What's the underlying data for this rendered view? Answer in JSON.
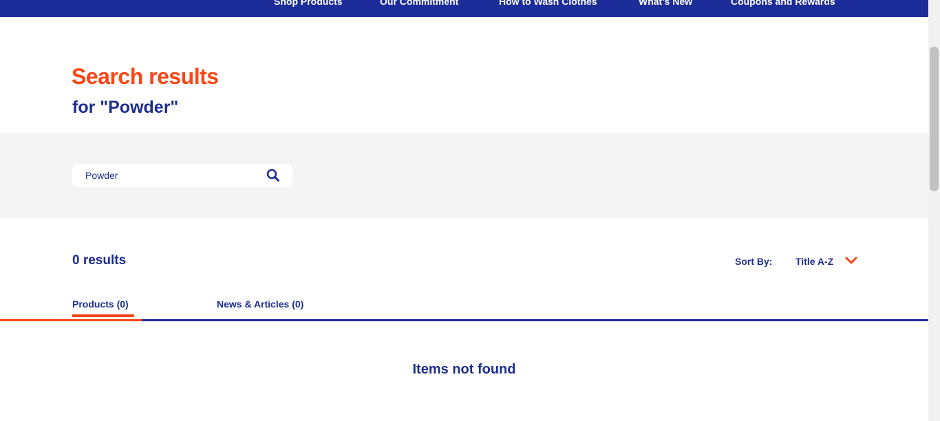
{
  "nav": {
    "items": [
      {
        "label": "Shop Products"
      },
      {
        "label": "Our Commitment"
      },
      {
        "label": "How to Wash Clothes"
      },
      {
        "label": "What's New"
      },
      {
        "label": "Coupons and Rewards"
      }
    ]
  },
  "header": {
    "title": "Search results",
    "subtitle": "for \"Powder\""
  },
  "search": {
    "value": "Powder",
    "icon": "search-icon"
  },
  "results": {
    "count_label": "0 results",
    "sort_label": "Sort By:",
    "sort_value": "Title A-Z"
  },
  "tabs": [
    {
      "label": "Products (0)",
      "active": true
    },
    {
      "label": "News & Articles (0)",
      "active": false
    }
  ],
  "empty_message": "Items not found",
  "colors": {
    "brand_blue": "#1c2d99",
    "accent_orange": "#fa4616",
    "band_gray": "#f4f4f4"
  }
}
